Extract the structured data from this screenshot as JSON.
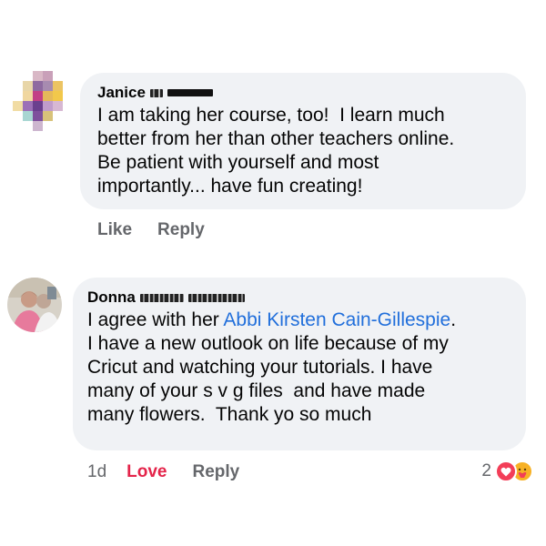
{
  "comments": [
    {
      "author": "Janice",
      "text": "I am taking her course, too!  I learn much\nbetter from her than other teachers online.\nBe patient with yourself and most\nimportantly... have fun creating!",
      "actions": {
        "like": "Like",
        "reply": "Reply"
      }
    },
    {
      "author": "Donna",
      "text_before_tag": "I agree with her ",
      "tagged_name": "Abbi Kirsten Cain-Gillespie",
      "text_after_tag": ".\nI have a new outlook on life because of my\nCricut and watching your tutorials. I have\nmany of your s v g files  and have made\nmany flowers.  Thank yo so much",
      "timestamp": "1d",
      "actions": {
        "love": "Love",
        "reply": "Reply"
      },
      "reaction_count": "2",
      "reaction_icons": [
        "love-icon",
        "care-icon"
      ]
    }
  ],
  "colors": {
    "bubble": "#f0f2f5",
    "link": "#216fdb",
    "love": "#e4244a",
    "muted": "#65676b"
  }
}
